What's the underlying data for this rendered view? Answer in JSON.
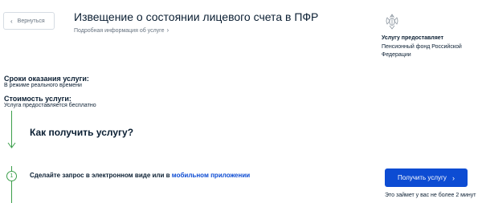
{
  "header": {
    "back_label": "Вернуться",
    "title": "Извещение о состоянии лицевого счета в ПФР",
    "details_link": "Подробная информация об услуге"
  },
  "provider": {
    "emblem_icon": "russian-coat-of-arms-icon",
    "caption": "Услугу предоставляет",
    "name": "Пенсионный фонд Российской Федерации"
  },
  "info": {
    "timing_label": "Сроки оказания услуги:",
    "timing_value": "В режиме реального времени",
    "cost_label": "Стоимость услуги:",
    "cost_value": "Услуга предоставляется бесплатно"
  },
  "how": {
    "title": "Как получить услугу?"
  },
  "step": {
    "number": "1",
    "text": "Сделайте запрос в электронном виде или в",
    "link": "мобильном приложении"
  },
  "action": {
    "button_label": "Получить услугу",
    "time_note": "Это займет у вас не более 2 минут"
  },
  "colors": {
    "primary": "#0d4cd3",
    "accent_green": "#3b9e4a",
    "text": "#0b1f33",
    "muted": "#66727f"
  }
}
